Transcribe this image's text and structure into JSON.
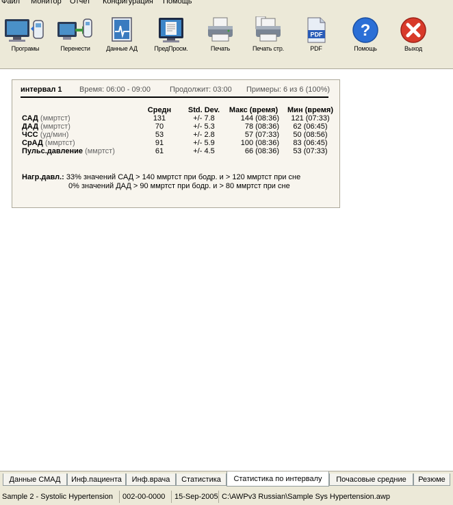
{
  "menu": [
    "Файл",
    "Монитор",
    "Отчет",
    "Конфигурация",
    "Помощь"
  ],
  "toolbar": {
    "programs": "Програмы",
    "transfer": "Перенести",
    "abpm_data": "Данные АД",
    "preview": "ПредПросм.",
    "print": "Печать",
    "print_page": "Печать стр.",
    "pdf": "PDF",
    "help": "Помощь",
    "exit": "Выход"
  },
  "report": {
    "interval_name": "интервал 1",
    "time": "Время: 06:00 - 09:00",
    "duration": "Продолжит: 03:00",
    "samples": "Примеры: 6 из 6 (100%)",
    "columns": [
      "Средн",
      "Std. Dev.",
      "Макс (время)",
      "Мин (время)"
    ],
    "rows": [
      {
        "name": "САД",
        "unit": "(ммртст)",
        "mean": "131",
        "sd": "+/- 7.8",
        "max": "144 (08:36)",
        "min": "121 (07:33)"
      },
      {
        "name": "ДАД",
        "unit": "(ммртст)",
        "mean": "70",
        "sd": "+/- 5.3",
        "max": "78 (08:36)",
        "min": "62 (06:45)"
      },
      {
        "name": "ЧСС",
        "unit": "(уд/мин)",
        "mean": "53",
        "sd": "+/- 2.8",
        "max": "57 (07:33)",
        "min": "50 (08:56)"
      },
      {
        "name": "СрАД",
        "unit": "(ммртст)",
        "mean": "91",
        "sd": "+/- 5.9",
        "max": "100 (08:36)",
        "min": "83 (06:45)"
      },
      {
        "name": "Пульс.давление",
        "unit": "(ммртст)",
        "mean": "61",
        "sd": "+/- 4.5",
        "max": "66 (08:36)",
        "min": "53 (07:33)"
      }
    ],
    "load_label": "Нагр.давл.:",
    "load_line1": "33% значений САД > 140 ммртст при бодр. и > 120 ммртст при сне",
    "load_line2": "0% значений ДАД > 90 ммртст при бодр. и > 80 ммртст при сне"
  },
  "tabs": [
    "Данные СМАД",
    "Инф.пациента",
    "Инф.врача",
    "Статистика",
    "Статистика по интервалу",
    "Почасовые средние",
    "Резюме"
  ],
  "active_tab": "Статистика по интервалу",
  "status": {
    "patient": "Sample 2 - Systolic Hypertension",
    "id": "002-00-0000",
    "date": "15-Sep-2005",
    "path": "C:\\AWPv3 Russian\\Sample Sys Hypertension.awp"
  },
  "colors": {
    "window_bg": "#ece9d8",
    "report_bg": "#f8f5ee",
    "help_blue": "#2b6fd6",
    "exit_red": "#d83a2a",
    "pdf_blue": "#2a5cb8"
  }
}
